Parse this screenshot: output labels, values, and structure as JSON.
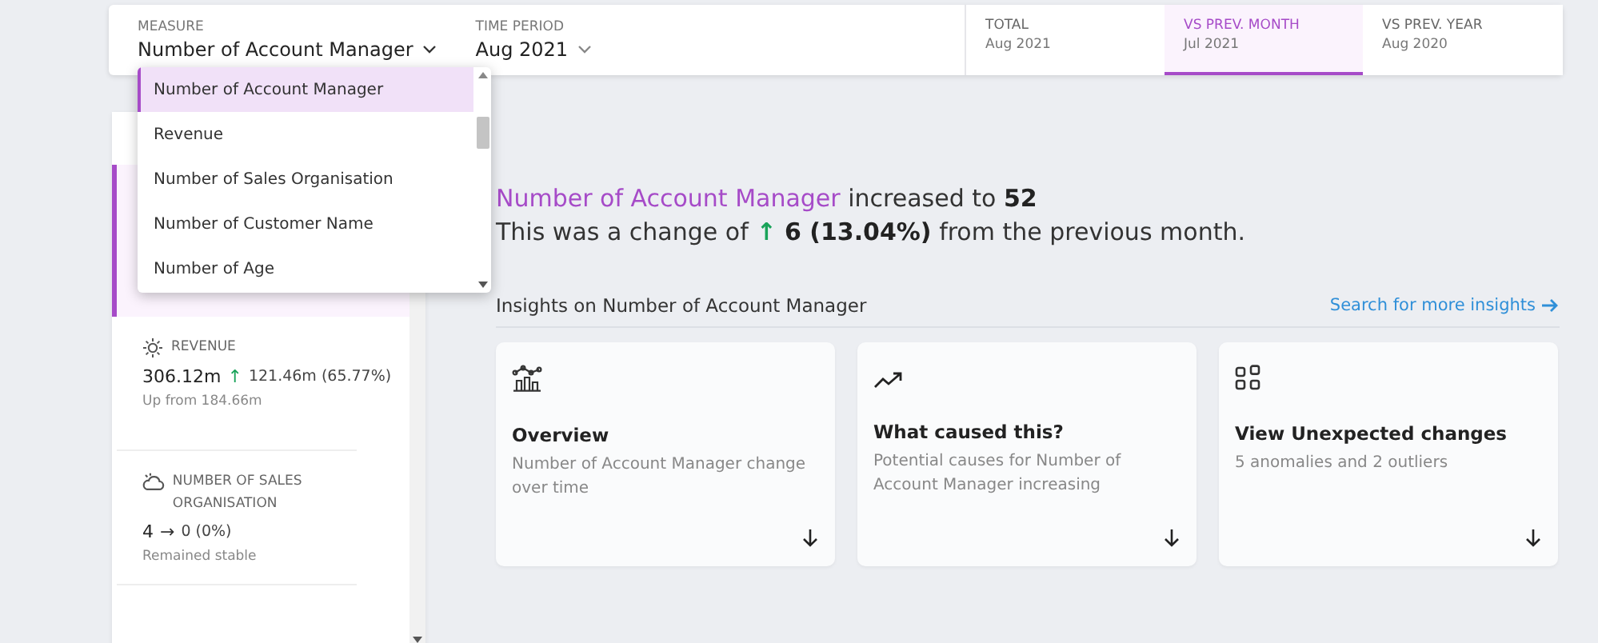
{
  "measure": {
    "label": "MEASURE",
    "value": "Number of Account Manager",
    "expanded": true
  },
  "time_period": {
    "label": "TIME PERIOD",
    "value": "Aug 2021",
    "expanded": false
  },
  "comparison_tabs": [
    {
      "label": "TOTAL",
      "period": "Aug 2021",
      "selected": false
    },
    {
      "label": "VS PREV. MONTH",
      "period": "Jul 2021",
      "selected": true
    },
    {
      "label": "VS PREV. YEAR",
      "period": "Aug 2020",
      "selected": false
    }
  ],
  "measure_menu": [
    {
      "label": "Number of Account Manager",
      "selected": true
    },
    {
      "label": "Revenue",
      "selected": false
    },
    {
      "label": "Number of Sales Organisation",
      "selected": false
    },
    {
      "label": "Number of Customer Name",
      "selected": false
    },
    {
      "label": "Number of Age",
      "selected": false
    }
  ],
  "sidebar": {
    "items": [
      {
        "selected": true
      },
      {
        "selected": false,
        "title": "REVENUE",
        "value": "306.12m",
        "trend": "↑",
        "change": "121.46m (65.77%)",
        "note": "Up from 184.66m"
      },
      {
        "selected": false,
        "title": "NUMBER OF SALES ORGANISATION",
        "value": "4",
        "trend": "→",
        "change": "0 (0%)",
        "note": "Remained stable"
      }
    ]
  },
  "headline": {
    "highlight": "Number of Account Manager",
    "rest": "increased to **52**",
    "change_prefix": "This was a change of",
    "trend": "↑",
    "change": "**6 (13.04%)** from the previous month."
  },
  "insights": {
    "title": "Insights on Number of Account Manager",
    "link": "Search for more insights",
    "cards": [
      {
        "title": "Overview",
        "description": "Number of Account Manager change over time"
      },
      {
        "title": "What caused this?",
        "description": "Potential causes for Number of Account Manager increasing"
      },
      {
        "title": "View Unexpected changes",
        "description": "5 anomalies and 2 outliers"
      }
    ]
  }
}
